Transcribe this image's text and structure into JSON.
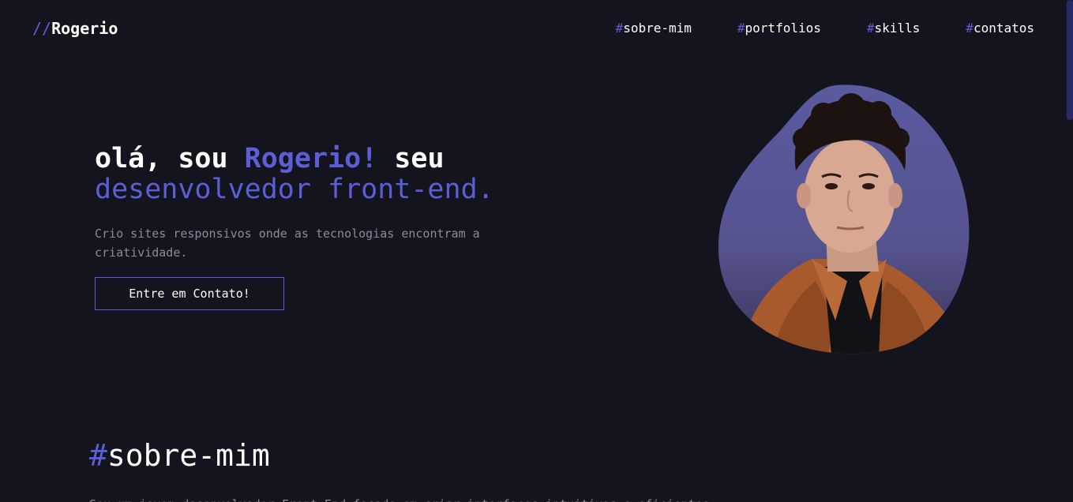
{
  "header": {
    "logo_slashes": "//",
    "logo_name": "Rogerio",
    "nav": [
      {
        "hash": "#",
        "label": "sobre-mim"
      },
      {
        "hash": "#",
        "label": "portfolios"
      },
      {
        "hash": "#",
        "label": "skills"
      },
      {
        "hash": "#",
        "label": "contatos"
      }
    ]
  },
  "hero": {
    "title_part1": "olá, sou ",
    "title_name": "Rogerio!",
    "title_part2": " seu",
    "title_line2": "desenvolvedor front-end.",
    "subtitle": "Crio sites responsivos onde as tecnologias encontram a criatividade.",
    "cta_label": "Entre em Contato!"
  },
  "about": {
    "hash": "#",
    "title": "sobre-mim",
    "text": "Sou um jovem desenvolvedor Front-End focado em criar interfaces intuitivas e eficientes..."
  },
  "colors": {
    "background": "#14141f",
    "accent": "#5b5fd6",
    "muted_text": "#8a8a9a"
  },
  "icons": {
    "portrait": "portrait-photo"
  }
}
